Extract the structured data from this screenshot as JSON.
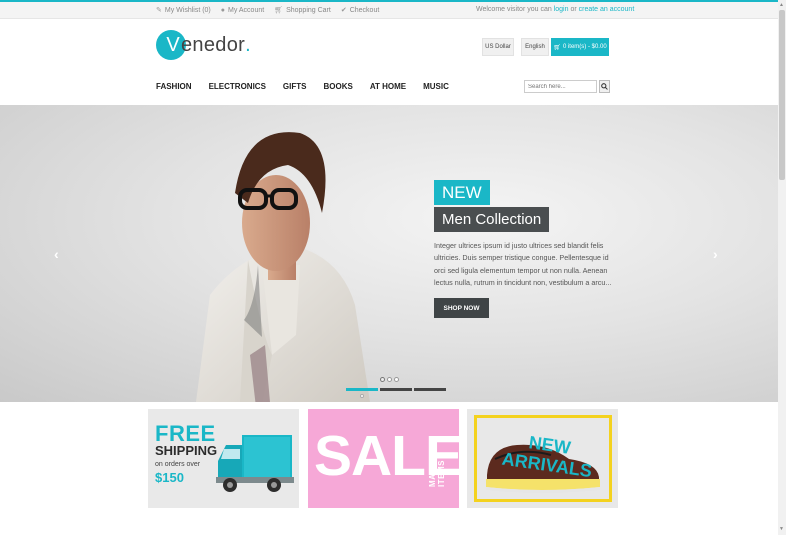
{
  "topbar": {
    "wishlist": "My Wishlist (0)",
    "account": "My Account",
    "cart": "Shopping Cart",
    "checkout": "Checkout",
    "welcome_prefix": "Welcome visitor you can",
    "login": "login",
    "or": "or",
    "create": "create an account"
  },
  "header": {
    "logo_initial": "V",
    "logo_rest": "enedor",
    "logo_dot": ".",
    "currency": "US Dollar",
    "language": "English",
    "cart_summary": "0 item(s) - $0.00"
  },
  "nav": {
    "items": [
      "FASHION",
      "ELECTRONICS",
      "GIFTS",
      "BOOKS",
      "AT HOME",
      "MUSIC"
    ],
    "search_placeholder": "Search here..."
  },
  "hero": {
    "tag": "NEW",
    "title": "Men Collection",
    "description": "Integer ultrices ipsum id justo ultrices sed blandit felis ultricies. Duis semper tristique congue. Pellentesque id orci sed ligula elementum tempor ut non nulla. Aenean lectus nulla, rutrum in tincidunt non, vestibulum a arcu...",
    "button": "SHOP NOW",
    "prev_arrow": "‹",
    "next_arrow": "›",
    "active_slide": 1,
    "slide_count": 3
  },
  "banners": {
    "shipping": {
      "line1": "FREE",
      "line2": "SHIPPING",
      "line3": "on orders over",
      "line4": "$150"
    },
    "sale": {
      "word": "SALE",
      "side": "MANY ITEMS"
    },
    "new_arrivals": {
      "line1": "NEW",
      "line2": "ARRIVALS"
    }
  },
  "colors": {
    "accent": "#1ab7c7",
    "dark": "#4a4e50",
    "sale_pink": "#f6a8d7",
    "frame_yellow": "#f4d21e"
  }
}
